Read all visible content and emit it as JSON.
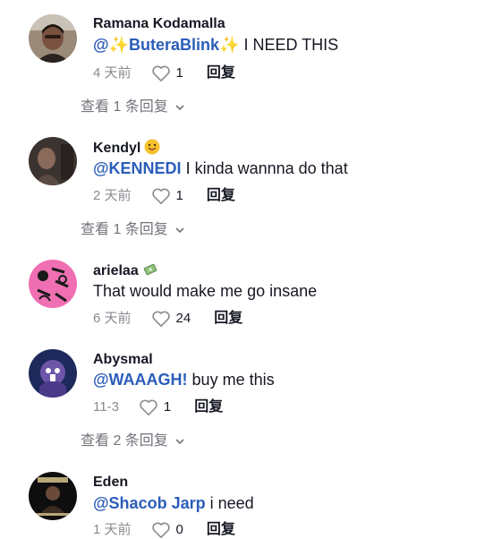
{
  "comments": [
    {
      "username": "Ramana Kodamalla",
      "mention_prefix": "@",
      "mention_name": "ButeraBlink",
      "text": " I NEED THIS",
      "time": "4 天前",
      "likes": "1",
      "reply_label": "回复",
      "view_replies": "查看 1 条回复"
    },
    {
      "username": "Kendyl",
      "mention": "@KENNEDI",
      "text": " I kinda wannna do that",
      "time": "2 天前",
      "likes": "1",
      "reply_label": "回复",
      "view_replies": "查看 1 条回复"
    },
    {
      "username": "arielaa",
      "text": "That would make me go insane",
      "time": "6 天前",
      "likes": "24",
      "reply_label": "回复"
    },
    {
      "username": "Abysmal",
      "mention": "@WAAAGH!",
      "text": " buy me this",
      "time": "11-3",
      "likes": "1",
      "reply_label": "回复",
      "view_replies": "查看 2 条回复"
    },
    {
      "username": "Eden",
      "mention": "@Shacob Jarp",
      "text": " i need",
      "time": "1 天前",
      "likes": "0",
      "reply_label": "回复"
    }
  ],
  "colors": {
    "mention": "#2b5db9",
    "text": "#161823",
    "muted": "#8a8b91"
  }
}
